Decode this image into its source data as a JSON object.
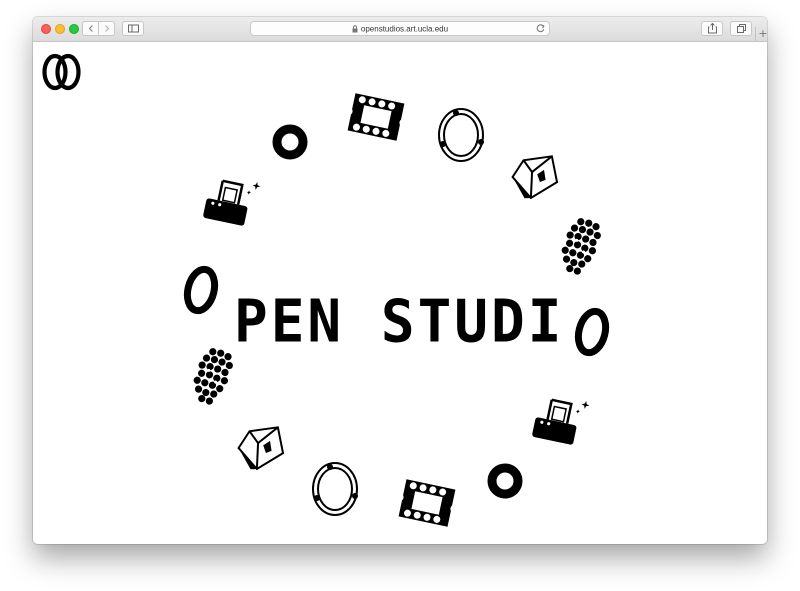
{
  "browser": {
    "url": "openstudios.art.ucla.edu",
    "new_tab_label": "+"
  },
  "page": {
    "headline": "PEN STUDI",
    "ring_letter_left": "O",
    "ring_letter_right": "O"
  },
  "icons": {
    "logo": "double-o-logo",
    "ring_shapes": [
      "donut",
      "stamp-frame",
      "orbit-ring",
      "hand-cube",
      "dot-cluster",
      "pedestal-sparkle"
    ]
  },
  "colors": {
    "ink": "#000000",
    "background": "#ffffff",
    "chrome": "#e2e2e2"
  }
}
